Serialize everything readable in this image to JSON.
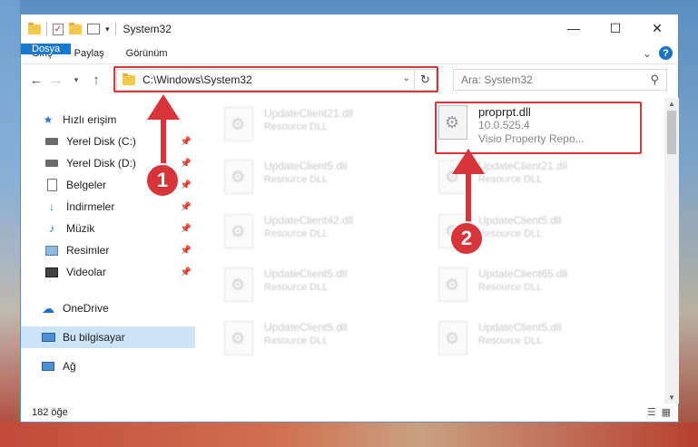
{
  "window": {
    "title": "System32",
    "controls": [
      "—",
      "☐",
      "✕"
    ]
  },
  "ribbon": {
    "tabs": [
      "Dosya",
      "Giriş",
      "Paylaş",
      "Görünüm"
    ],
    "expand": "⌄",
    "help": "?"
  },
  "address": {
    "path": "C:\\Windows\\System32",
    "search_placeholder": "Ara: System32"
  },
  "sidebar": {
    "quick_access": "Hızlı erişim",
    "items": [
      {
        "label": "Yerel Disk (C:)",
        "icon": "drive-icon"
      },
      {
        "label": "Yerel Disk (D:)",
        "icon": "drive-icon"
      },
      {
        "label": "Belgeler",
        "icon": "documents-icon"
      },
      {
        "label": "İndirmeler",
        "icon": "downloads-icon"
      },
      {
        "label": "Müzik",
        "icon": "music-icon"
      },
      {
        "label": "Resimler",
        "icon": "pictures-icon"
      },
      {
        "label": "Videolar",
        "icon": "videos-icon"
      }
    ],
    "onedrive": "OneDrive",
    "this_pc": "Bu bilgisayar",
    "network": "Ağ"
  },
  "files": {
    "highlight": {
      "name": "proprpt.dll",
      "version": "10.0.525.4",
      "description": "Visio Property Repo..."
    },
    "left_column": [
      {
        "name": "UpdateClient21.dll",
        "type": "Resource DLL"
      },
      {
        "name": "UpdateClient5.dll",
        "type": "Resource DLL"
      },
      {
        "name": "UpdateClient42.dll",
        "type": "Resource DLL"
      },
      {
        "name": "UpdateClient5.dll",
        "type": "Resource DLL"
      },
      {
        "name": "UpdateClient5.dll",
        "type": "Resource DLL"
      }
    ],
    "right_column": [
      {
        "name": "UpdateClient21.dll",
        "type": "Resource DLL"
      },
      {
        "name": "UpdateClient5.dll",
        "type": "Resource DLL"
      },
      {
        "name": "UpdateClient65.dll",
        "type": "Resource DLL"
      },
      {
        "name": "UpdateClient5.dll",
        "type": "Resource DLL"
      }
    ]
  },
  "status": {
    "count": "182 öğe"
  },
  "annotations": {
    "badge1": "1",
    "badge2": "2",
    "color": "#d7353a"
  }
}
